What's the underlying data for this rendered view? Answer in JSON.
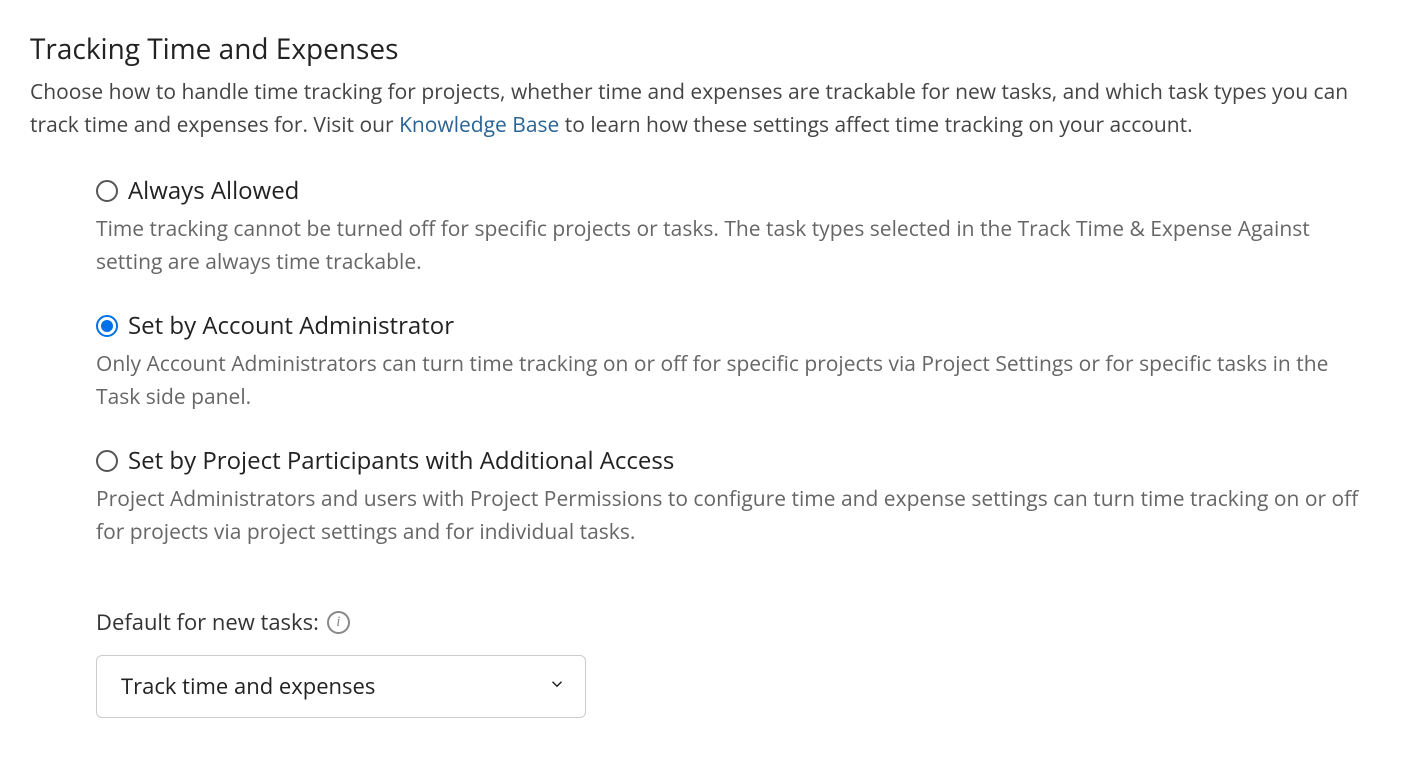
{
  "section": {
    "title": "Tracking Time and Expenses",
    "desc_before": "Choose how to handle time tracking for projects, whether time and expenses are trackable for new tasks, and which task types you can track time and expenses for. Visit our ",
    "link_text": "Knowledge Base",
    "desc_after": " to learn how these settings affect time tracking on your account."
  },
  "options": [
    {
      "title": "Always Allowed",
      "desc": "Time tracking cannot be turned off for specific projects or tasks. The task types selected in the Track Time & Expense Against setting are always time trackable.",
      "selected": false
    },
    {
      "title": "Set by Account Administrator",
      "desc": "Only Account Administrators can turn time tracking on or off for specific projects via Project Settings or for specific tasks in the Task side panel.",
      "selected": true
    },
    {
      "title": "Set by Project Participants with Additional Access",
      "desc": "Project Administrators and users with Project Permissions to configure time and expense settings can turn time tracking on or off for projects via project settings and for individual tasks.",
      "selected": false
    }
  ],
  "default": {
    "label": "Default for new tasks:",
    "info_sym": "i",
    "select_value": "Track time and expenses"
  }
}
